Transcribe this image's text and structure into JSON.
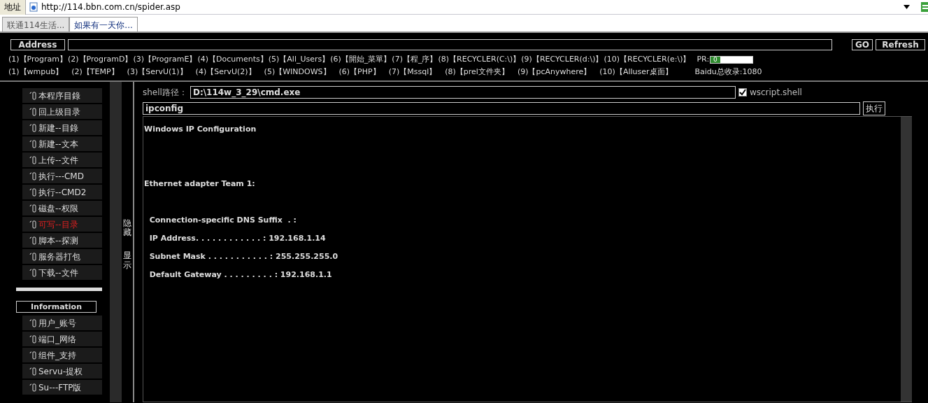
{
  "browser": {
    "address_label": "地址",
    "url": "http://114.bbn.com.cn/spider.asp"
  },
  "tabs": [
    {
      "label": "联通114生活...",
      "selected": false
    },
    {
      "label": "如果有一天你...",
      "selected": true
    }
  ],
  "address_bar": {
    "label": "Address",
    "go": "GO",
    "refresh": "Refresh"
  },
  "link_rows": [
    {
      "links": [
        "(1)【Program】",
        "(2)【ProgramD】",
        "(3)【ProgramE】",
        "(4)【Documents】",
        "(5)【All_Users】",
        "(6)【開始_菜單】",
        "(7)【程_序】",
        "(8)【RECYCLER(C:\\)】",
        "(9)【RECYCLER(d:\\)】",
        "(10)【RECYCLER(e:\\)】"
      ],
      "pr": {
        "label": "PR:",
        "value": "0",
        "level": 0
      }
    },
    {
      "links": [
        "(1)【wmpub】",
        "(2)【TEMP】",
        "(3)【ServU(1)】",
        "(4)【ServU(2)】",
        "(5)【WINDOWS】",
        "(6)【PHP】",
        "(7)【Mssql】",
        "(8)【prel文件夹】",
        "(9)【pcAnywhere】",
        "(10)【Alluser桌面】"
      ],
      "baidu": "Baidu总收录:1080"
    }
  ],
  "sidebar": {
    "groups": [
      {
        "items": [
          {
            "label": "本程序目錄",
            "active": false
          },
          {
            "label": "回上级目录",
            "active": false
          },
          {
            "label": "新建--目錄",
            "active": false
          },
          {
            "label": "新建--文本",
            "active": false
          },
          {
            "label": "上传--文件",
            "active": false
          },
          {
            "label": "执行---CMD",
            "active": false
          },
          {
            "label": "执行--CMD2",
            "active": false
          },
          {
            "label": "磁盘--权限",
            "active": false
          },
          {
            "label": "可写--目录",
            "active": true
          },
          {
            "label": "脚本--探测",
            "active": false
          },
          {
            "label": "服务器打包",
            "active": false
          },
          {
            "label": "下载--文件",
            "active": false
          }
        ]
      },
      {
        "title": "Information",
        "items": [
          {
            "label": "用户_账号",
            "active": false
          },
          {
            "label": "端口_网络",
            "active": false
          },
          {
            "label": "组件_支持",
            "active": false
          },
          {
            "label": "Servu-提权",
            "active": false
          },
          {
            "label": "Su---FTP版",
            "active": false
          }
        ]
      }
    ]
  },
  "toggle": {
    "hide": "隐藏",
    "show": "显示"
  },
  "shell": {
    "path_label": "shell路径：",
    "path": "D:\\114w_3_29\\cmd.exe",
    "wscript_label": "wscript.shell",
    "wscript_checked": true,
    "command": "ipconfig",
    "run": "执行",
    "output": "Windows IP Configuration\n\n\nEthernet adapter Team 1:\n\n  Connection-specific DNS Suffix  . :\n  IP Address. . . . . . . . . . . . : 192.168.1.14\n  Subnet Mask . . . . . . . . . . . : 255.255.255.0\n  Default Gateway . . . . . . . . . : 192.168.1.1"
  }
}
